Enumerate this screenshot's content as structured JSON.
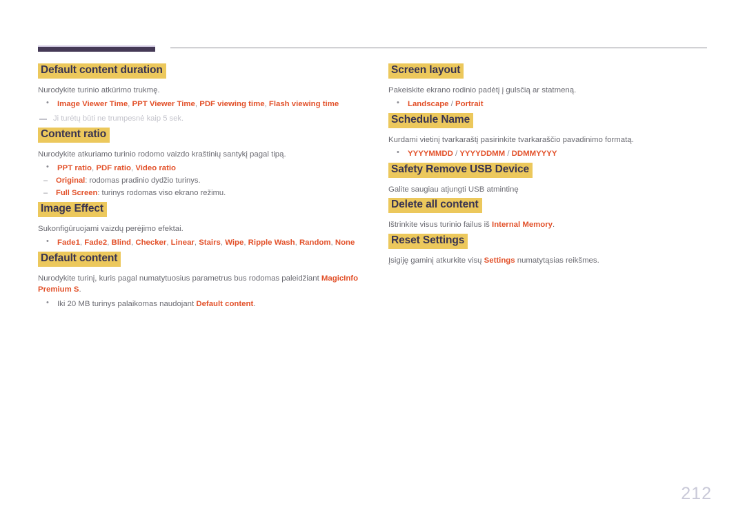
{
  "page": {
    "number": "212",
    "language": "lt"
  },
  "header": {
    "thick_bar_color": "#453a56",
    "thin_rule_color": "#8d8d95"
  },
  "theme": {
    "heading_highlight": "#ecc85c",
    "heading_text": "#383350",
    "body_text": "#6b6b72",
    "accent": "#e2512a",
    "note_text": "#c3c3cb",
    "page_number_color": "#c9c9d8"
  },
  "left_column": {
    "sections": [
      {
        "title": "Default content duration",
        "desc": "Nurodykite turinio atkūrimo trukmę.",
        "bullets": [
          {
            "parts": [
              {
                "text": "Image Viewer Time",
                "style": "hl"
              },
              {
                "text": ", ",
                "style": "sep"
              },
              {
                "text": "PPT Viewer Time",
                "style": "hl"
              },
              {
                "text": ", ",
                "style": "sep"
              },
              {
                "text": "PDF viewing time",
                "style": "hl"
              },
              {
                "text": ", ",
                "style": "sep"
              },
              {
                "text": "Flash viewing time",
                "style": "hl"
              }
            ]
          }
        ],
        "note": "Ji turėtų būti ne trumpesnė kaip 5 sek."
      },
      {
        "title": "Content ratio",
        "desc": "Nurodykite atkuriamo turinio rodomo vaizdo kraštinių santykį pagal tipą.",
        "bullets": [
          {
            "parts": [
              {
                "text": "PPT ratio",
                "style": "hl"
              },
              {
                "text": ", ",
                "style": "sep"
              },
              {
                "text": "PDF ratio",
                "style": "hl"
              },
              {
                "text": ", ",
                "style": "sep"
              },
              {
                "text": "Video ratio",
                "style": "hl"
              }
            ],
            "subbullets": [
              {
                "parts": [
                  {
                    "text": "Original",
                    "style": "hl"
                  },
                  {
                    "text": ": rodomas pradinio dydžio turinys.",
                    "style": "plain"
                  }
                ]
              },
              {
                "parts": [
                  {
                    "text": "Full Screen",
                    "style": "hl"
                  },
                  {
                    "text": ": turinys rodomas viso ekrano režimu.",
                    "style": "plain"
                  }
                ]
              }
            ]
          }
        ]
      },
      {
        "title": "Image Effect",
        "desc": "Sukonfigūruojami vaizdų perėjimo efektai.",
        "bullets": [
          {
            "parts": [
              {
                "text": "Fade1",
                "style": "hl"
              },
              {
                "text": ", ",
                "style": "sep"
              },
              {
                "text": "Fade2",
                "style": "hl"
              },
              {
                "text": ", ",
                "style": "sep"
              },
              {
                "text": "Blind",
                "style": "hl"
              },
              {
                "text": ", ",
                "style": "sep"
              },
              {
                "text": "Checker",
                "style": "hl"
              },
              {
                "text": ", ",
                "style": "sep"
              },
              {
                "text": "Linear",
                "style": "hl"
              },
              {
                "text": ", ",
                "style": "sep"
              },
              {
                "text": "Stairs",
                "style": "hl"
              },
              {
                "text": ", ",
                "style": "sep"
              },
              {
                "text": "Wipe",
                "style": "hl"
              },
              {
                "text": ", ",
                "style": "sep"
              },
              {
                "text": "Ripple Wash",
                "style": "hl"
              },
              {
                "text": ", ",
                "style": "sep"
              },
              {
                "text": "Random",
                "style": "hl"
              },
              {
                "text": ", ",
                "style": "sep"
              },
              {
                "text": "None",
                "style": "hl"
              }
            ]
          }
        ]
      },
      {
        "title": "Default content",
        "desc_parts": [
          {
            "text": "Nurodykite turinį, kuris pagal numatytuosius parametrus bus rodomas paleidžiant ",
            "style": "plain"
          },
          {
            "text": "MagicInfo Premium S",
            "style": "hl"
          },
          {
            "text": ".",
            "style": "plain"
          }
        ],
        "bullets": [
          {
            "parts": [
              {
                "text": "Iki 20 MB turinys palaikomas naudojant ",
                "style": "plain"
              },
              {
                "text": "Default content",
                "style": "hl"
              },
              {
                "text": ".",
                "style": "plain"
              }
            ]
          }
        ]
      }
    ]
  },
  "right_column": {
    "sections": [
      {
        "title": "Screen layout",
        "desc": "Pakeiskite ekrano rodinio padėtį į gulsčią ar statmeną.",
        "bullets": [
          {
            "parts": [
              {
                "text": "Landscape",
                "style": "hl"
              },
              {
                "text": " / ",
                "style": "sep"
              },
              {
                "text": "Portrait",
                "style": "hl"
              }
            ]
          }
        ]
      },
      {
        "title": "Schedule Name",
        "desc": "Kurdami vietinį tvarkaraštį pasirinkite tvarkaraščio pavadinimo formatą.",
        "bullets": [
          {
            "parts": [
              {
                "text": "YYYYMMDD",
                "style": "hl"
              },
              {
                "text": " / ",
                "style": "sep"
              },
              {
                "text": "YYYYDDMM",
                "style": "hl"
              },
              {
                "text": " / ",
                "style": "sep"
              },
              {
                "text": "DDMMYYYY",
                "style": "hl"
              }
            ]
          }
        ]
      },
      {
        "title": "Safety Remove USB Device",
        "desc": "Galite saugiau atjungti USB atmintinę"
      },
      {
        "title": "Delete all content",
        "desc_parts": [
          {
            "text": "Ištrinkite visus turinio failus iš ",
            "style": "plain"
          },
          {
            "text": "Internal Memory",
            "style": "hl"
          },
          {
            "text": ".",
            "style": "plain"
          }
        ]
      },
      {
        "title": "Reset Settings",
        "desc_parts": [
          {
            "text": "Įsigiję gaminį atkurkite visų ",
            "style": "plain"
          },
          {
            "text": "Settings",
            "style": "hl"
          },
          {
            "text": " numatytąsias reikšmes.",
            "style": "plain"
          }
        ]
      }
    ]
  }
}
